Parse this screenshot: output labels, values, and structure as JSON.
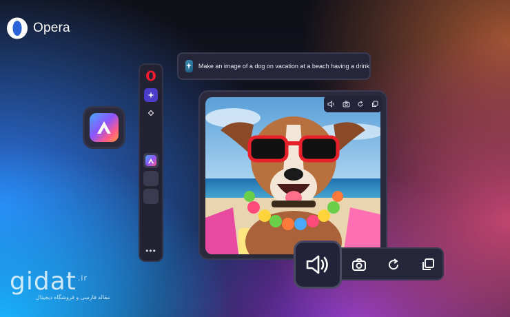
{
  "brand": {
    "name": "Opera",
    "logo_icon": "opera-logo-icon"
  },
  "prompt": {
    "text": "Make an image of a dog on vacation at a beach having a drink",
    "icon": "image-generation-icon"
  },
  "aria_tile": {
    "icon": "aria-icon"
  },
  "sidebar": {
    "items": [
      {
        "icon": "opera-logo-icon"
      },
      {
        "icon": "sparkle-icon",
        "active": true
      },
      {
        "icon": "diamond-icon"
      },
      {
        "icon": "aria-icon"
      },
      {
        "icon": "blank-slot"
      },
      {
        "icon": "blank-slot"
      }
    ],
    "more_label": "•••"
  },
  "image_card": {
    "image_subject": "Dog wearing red sunglasses and a flower lei at the beach",
    "mini_toolbar": [
      "speaker-icon",
      "camera-icon",
      "refresh-icon",
      "copy-icon"
    ]
  },
  "big_toolbar": {
    "buttons": [
      "speaker-icon",
      "camera-icon",
      "refresh-icon",
      "copy-icon"
    ]
  },
  "watermark": {
    "main": "gidat",
    "tld": ".ir",
    "subtitle": "مقاله فارسی و فروشگاه دیجیتال"
  },
  "colors": {
    "accent": "#4b3cc9",
    "panel": "#26263a",
    "opera_red": "#ff1b2d"
  }
}
